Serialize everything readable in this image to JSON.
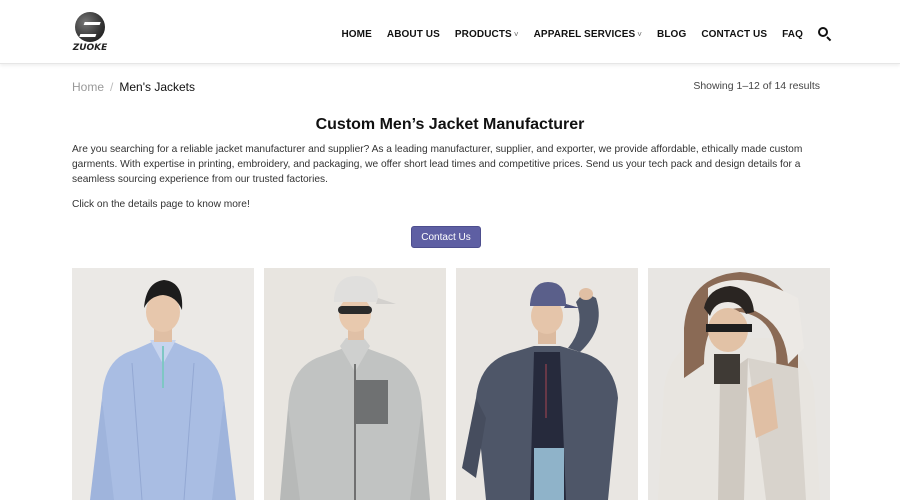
{
  "brand": {
    "logo_text": "ZUOKE"
  },
  "nav": {
    "items": [
      {
        "label": "HOME",
        "dropdown": false
      },
      {
        "label": "ABOUT US",
        "dropdown": false
      },
      {
        "label": "PRODUCTS",
        "dropdown": true
      },
      {
        "label": "APPAREL SERVICES",
        "dropdown": true
      },
      {
        "label": "BLOG",
        "dropdown": false
      },
      {
        "label": "CONTACT US",
        "dropdown": false
      },
      {
        "label": "FAQ",
        "dropdown": false
      }
    ],
    "dropdown_glyph": "˅",
    "search_icon": "search-icon"
  },
  "breadcrumb": {
    "home": "Home",
    "separator": "/",
    "current": "Men's Jackets"
  },
  "results": "Showing 1–12 of 14 results",
  "intro": {
    "title": "Custom Men’s Jacket Manufacturer",
    "paragraph": "Are you searching for a reliable jacket manufacturer and supplier? As a leading manufacturer, supplier, and exporter, we provide affordable, ethically made custom garments. With expertise in printing, embroidery, and packaging, we offer short lead times and competitive prices. Send us your tech pack and design details for a seamless sourcing experience from our trusted factories.",
    "cta_text": "Click on the details page to know more!",
    "button_label": "Contact Us"
  },
  "colors": {
    "accent": "#5e5fa3",
    "card_bg": "#e9e6e1"
  },
  "products": [
    {
      "image": "model in light blue pullover jacket",
      "jacket_color": "#a9bde3"
    },
    {
      "image": "model in grey fleece zip jacket",
      "jacket_color": "#b9bcbc"
    },
    {
      "image": "model in navy windbreaker",
      "jacket_color": "#4d5566"
    },
    {
      "image": "model in white and brown hooded shell jacket",
      "jacket_color": "#e7e4df"
    }
  ]
}
